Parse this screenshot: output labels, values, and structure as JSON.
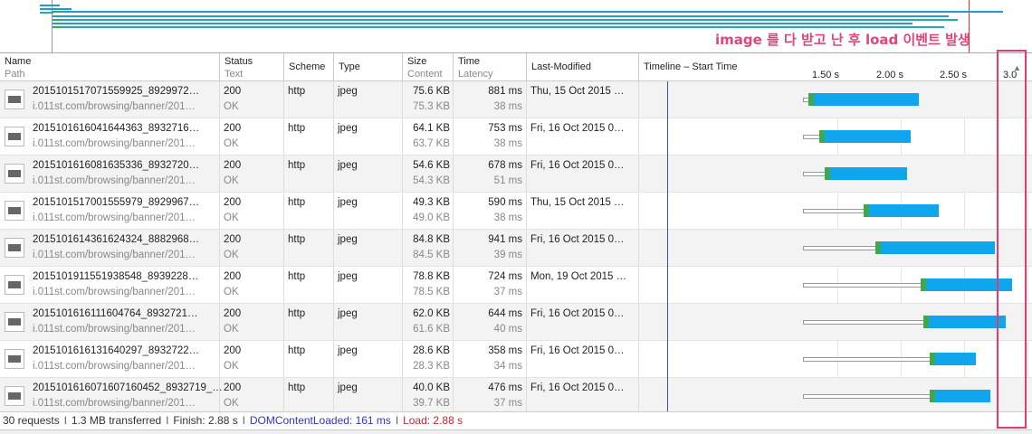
{
  "annotation": {
    "label": "image 를 다 받고 난 후 load 이벤트 발생",
    "color": "#e43a6f"
  },
  "columns": {
    "name": {
      "label": "Name",
      "sub": "Path"
    },
    "status": {
      "label": "Status",
      "sub": "Text"
    },
    "scheme": {
      "label": "Scheme"
    },
    "type": {
      "label": "Type"
    },
    "size": {
      "label": "Size",
      "sub": "Content"
    },
    "time": {
      "label": "Time",
      "sub": "Latency"
    },
    "last_modified": {
      "label": "Last-Modified"
    },
    "timeline": {
      "label": "Timeline – Start Time"
    }
  },
  "timeline_ticks": [
    {
      "label": "1.50 s"
    },
    {
      "label": "2.00 s"
    },
    {
      "label": "2.50 s"
    },
    {
      "label": "3.0"
    }
  ],
  "rows": [
    {
      "name": "2015101517071559925_8929972…",
      "path": "i.011st.com/browsing/banner/201…",
      "status": "200",
      "status_text": "OK",
      "scheme": "http",
      "type": "jpeg",
      "size": "75.6 KB",
      "content": "75.3 KB",
      "time": "881 ms",
      "latency": "38 ms",
      "last_modified": "Thu, 15 Oct 2015 …",
      "thumb_icon": "image-thumbnail-icon",
      "timing_s": {
        "start": 1.23,
        "response_start": 1.27,
        "end": 2.14
      }
    },
    {
      "name": "2015101616041644363_8932716…",
      "path": "i.011st.com/browsing/banner/201…",
      "status": "200",
      "status_text": "OK",
      "scheme": "http",
      "type": "jpeg",
      "size": "64.1 KB",
      "content": "63.7 KB",
      "time": "753 ms",
      "latency": "38 ms",
      "last_modified": "Fri, 16 Oct 2015 0…",
      "thumb_icon": "image-thumbnail-icon",
      "timing_s": {
        "start": 1.23,
        "response_start": 1.36,
        "end": 2.08
      }
    },
    {
      "name": "2015101616081635336_8932720…",
      "path": "i.011st.com/browsing/banner/201…",
      "status": "200",
      "status_text": "OK",
      "scheme": "http",
      "type": "jpeg",
      "size": "54.6 KB",
      "content": "54.3 KB",
      "time": "678 ms",
      "latency": "51 ms",
      "last_modified": "Fri, 16 Oct 2015 0…",
      "thumb_icon": "image-thumbnail-icon",
      "timing_s": {
        "start": 1.23,
        "response_start": 1.4,
        "end": 2.05
      }
    },
    {
      "name": "2015101517001555979_8929967…",
      "path": "i.011st.com/browsing/banner/201…",
      "status": "200",
      "status_text": "OK",
      "scheme": "http",
      "type": "jpeg",
      "size": "49.3 KB",
      "content": "49.0 KB",
      "time": "590 ms",
      "latency": "38 ms",
      "last_modified": "Thu, 15 Oct 2015 …",
      "thumb_icon": "image-thumbnail-icon",
      "timing_s": {
        "start": 1.23,
        "response_start": 1.71,
        "end": 2.3
      }
    },
    {
      "name": "2015101614361624324_8882968…",
      "path": "i.011st.com/browsing/banner/201…",
      "status": "200",
      "status_text": "OK",
      "scheme": "http",
      "type": "jpeg",
      "size": "84.8 KB",
      "content": "84.5 KB",
      "time": "941 ms",
      "latency": "39 ms",
      "last_modified": "Fri, 16 Oct 2015 0…",
      "thumb_icon": "image-thumbnail-icon",
      "timing_s": {
        "start": 1.23,
        "response_start": 1.8,
        "end": 2.74
      }
    },
    {
      "name": "2015101911551938548_8939228…",
      "path": "i.011st.com/browsing/banner/201…",
      "status": "200",
      "status_text": "OK",
      "scheme": "http",
      "type": "jpeg",
      "size": "78.8 KB",
      "content": "78.5 KB",
      "time": "724 ms",
      "latency": "37 ms",
      "last_modified": "Mon, 19 Oct 2015 …",
      "thumb_icon": "image-thumbnail-icon",
      "timing_s": {
        "start": 1.23,
        "response_start": 2.16,
        "end": 2.88
      }
    },
    {
      "name": "2015101616111604764_8932721…",
      "path": "i.011st.com/browsing/banner/201…",
      "status": "200",
      "status_text": "OK",
      "scheme": "http",
      "type": "jpeg",
      "size": "62.0 KB",
      "content": "61.6 KB",
      "time": "644 ms",
      "latency": "40 ms",
      "last_modified": "Fri, 16 Oct 2015 0…",
      "thumb_icon": "image-thumbnail-icon",
      "timing_s": {
        "start": 1.23,
        "response_start": 2.18,
        "end": 2.83
      }
    },
    {
      "name": "2015101616131640297_8932722…",
      "path": "i.011st.com/browsing/banner/201…",
      "status": "200",
      "status_text": "OK",
      "scheme": "http",
      "type": "jpeg",
      "size": "28.6 KB",
      "content": "28.3 KB",
      "time": "358 ms",
      "latency": "34 ms",
      "last_modified": "Fri, 16 Oct 2015 0…",
      "thumb_icon": "image-thumbnail-icon",
      "timing_s": {
        "start": 1.23,
        "response_start": 2.23,
        "end": 2.59
      }
    },
    {
      "name": "2015101616071607160452_8932719_…",
      "path": "i.011st.com/browsing/banner/201…",
      "status": "200",
      "status_text": "OK",
      "scheme": "http",
      "type": "jpeg",
      "size": "40.0 KB",
      "content": "39.7 KB",
      "time": "476 ms",
      "latency": "37 ms",
      "last_modified": "Fri, 16 Oct 2015 0…",
      "thumb_icon": "image-thumbnail-icon",
      "timing_s": {
        "start": 1.23,
        "response_start": 2.23,
        "end": 2.71
      }
    }
  ],
  "status_bar": {
    "requests": "30 requests",
    "transferred": "1.3 MB transferred",
    "finish": "Finish: 2.88 s",
    "dom_content_loaded": "DOMContentLoaded: 161 ms",
    "load": "Load: 2.88 s"
  },
  "colors": {
    "latency": "#3ea94a",
    "receiving": "#0fa6ee",
    "dom_content_loaded": "#2b37c8",
    "load": "#c6262e"
  }
}
